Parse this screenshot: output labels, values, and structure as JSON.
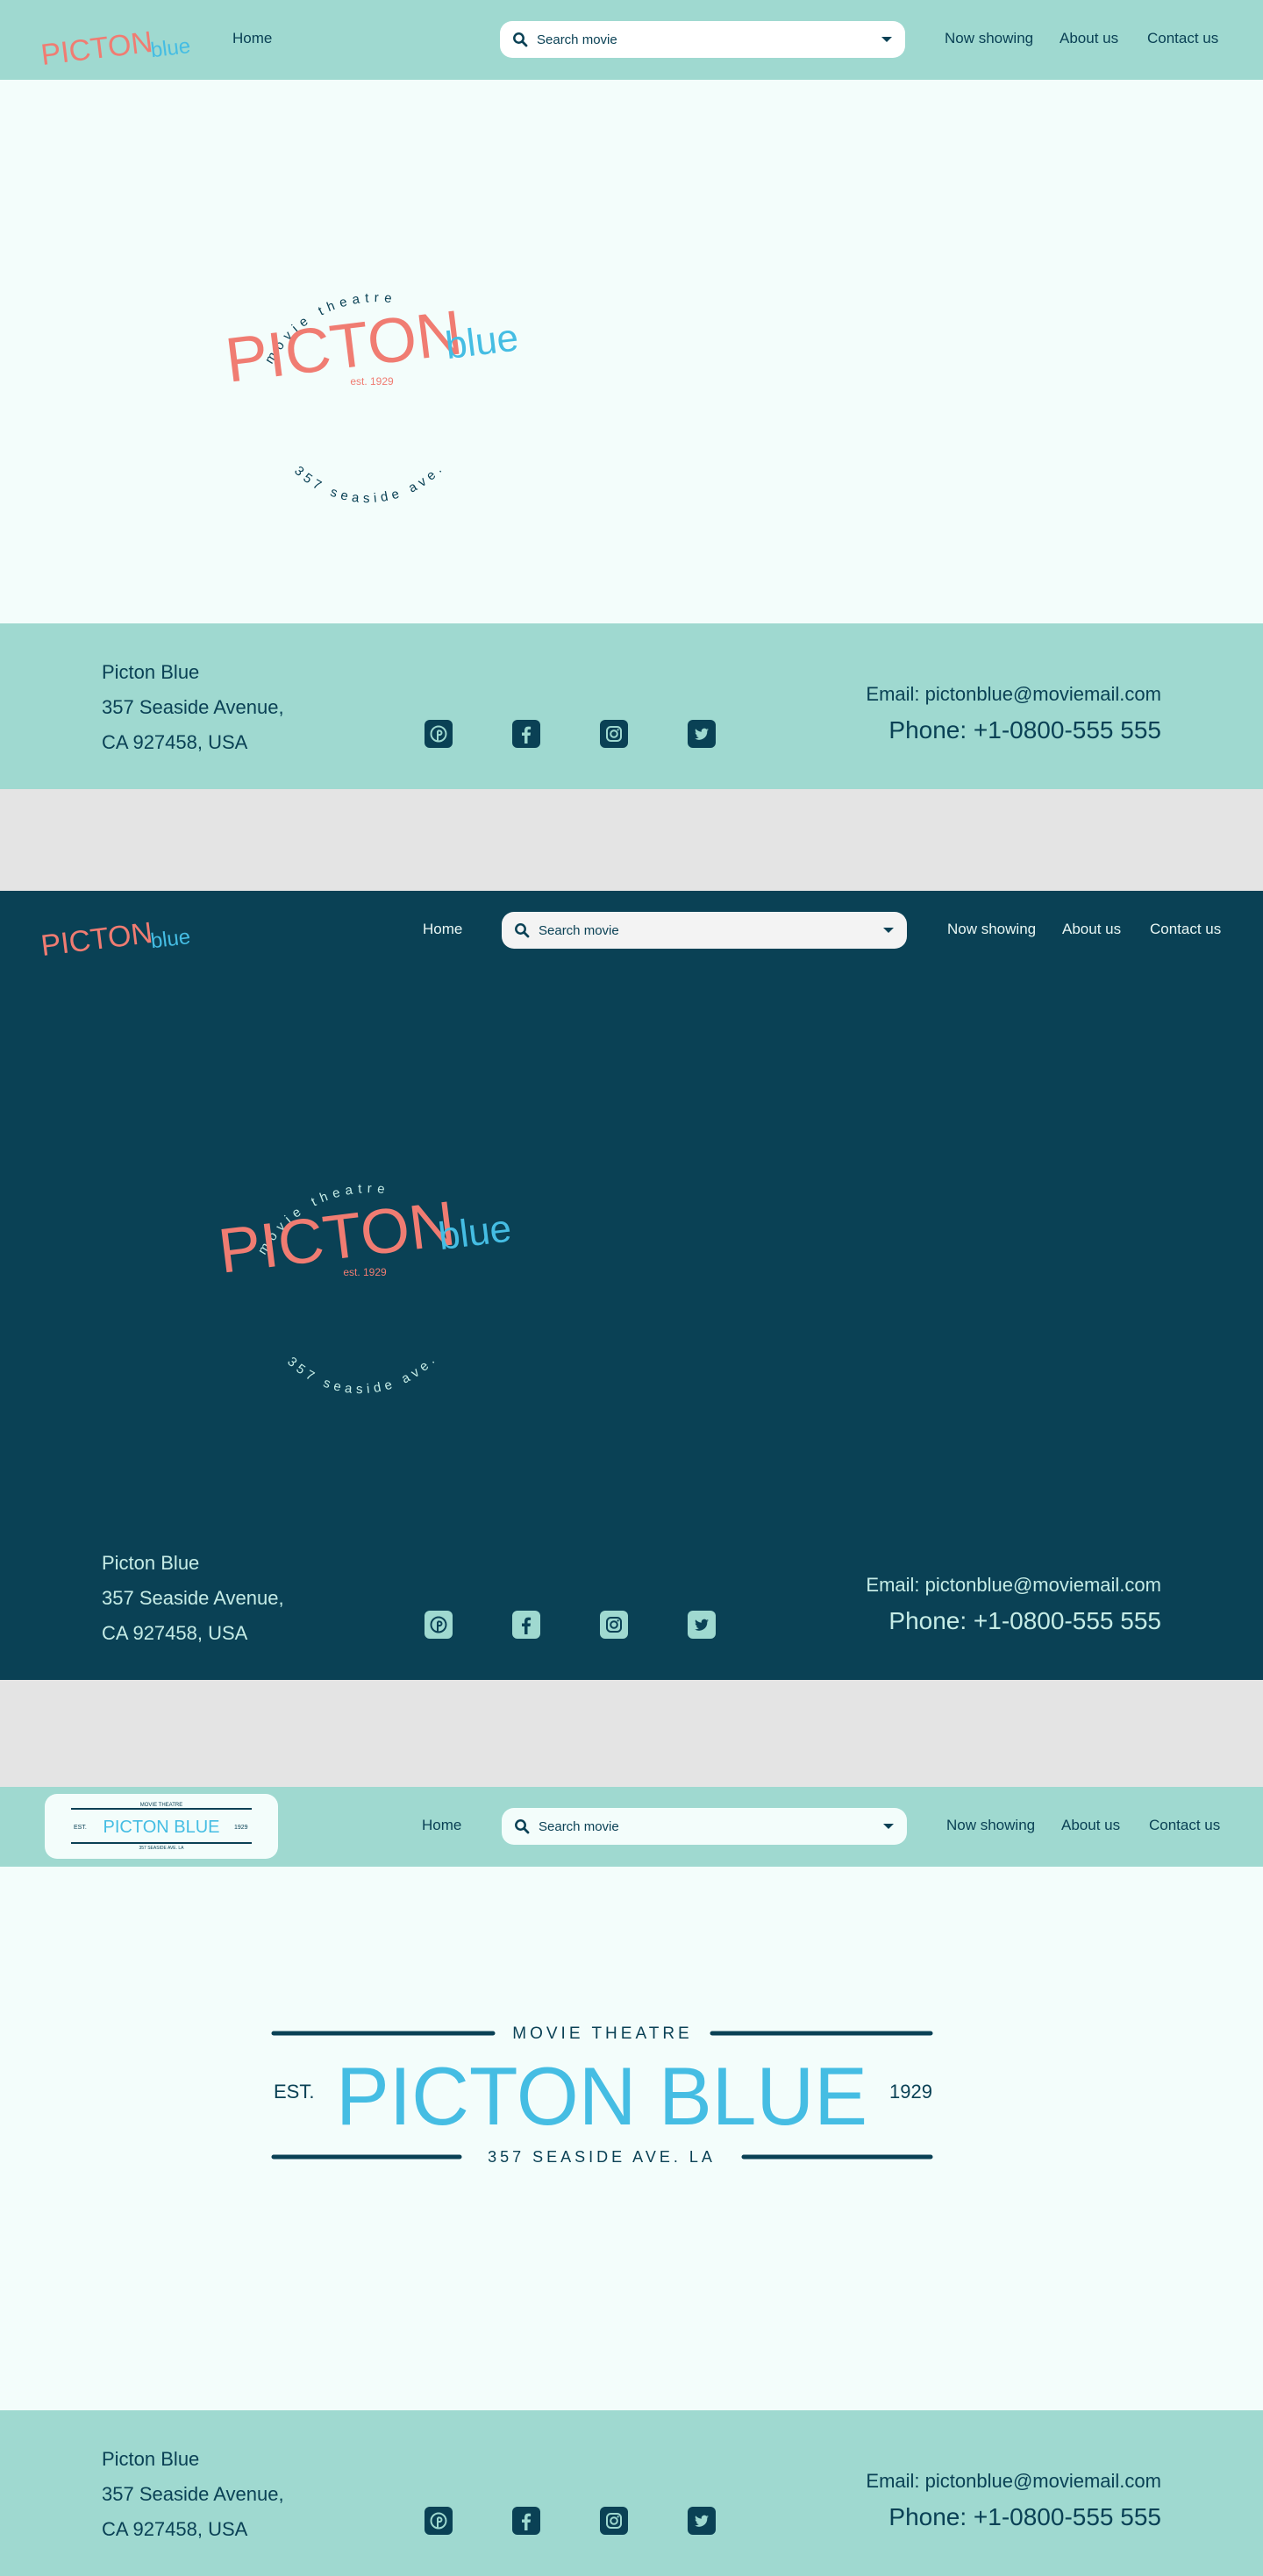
{
  "brand": {
    "word_main": "PICTON",
    "word_accent": "blue",
    "arc_top": "movie theatre",
    "arc_bottom": "357 seaside ave.",
    "est": "est. 1929",
    "banner_title": "PICTON BLUE",
    "banner_top": "MOVIE THEATRE",
    "banner_bottom": "357 SEASIDE AVE. LA",
    "banner_est_left": "EST.",
    "banner_est_right": "1929"
  },
  "nav": {
    "home": "Home",
    "search_placeholder": "Search movie",
    "now_showing": "Now showing",
    "about": "About us",
    "contact": "Contact us"
  },
  "footer": {
    "name": "Picton Blue",
    "street": "357 Seaside Avenue,",
    "city": "CA 927458, USA",
    "email": "Email: pictonblue@moviemail.com",
    "phone": "Phone: +1-0800-555 555",
    "socials": [
      "pinterest-icon",
      "facebook-icon",
      "instagram-icon",
      "twitter-icon"
    ]
  },
  "colors": {
    "mint": "#9fd9d0",
    "navy": "#0a4155",
    "coral": "#f07c72",
    "sky": "#45bde3",
    "off_white": "#f3fdfb",
    "gap": "#e4e4e4"
  }
}
